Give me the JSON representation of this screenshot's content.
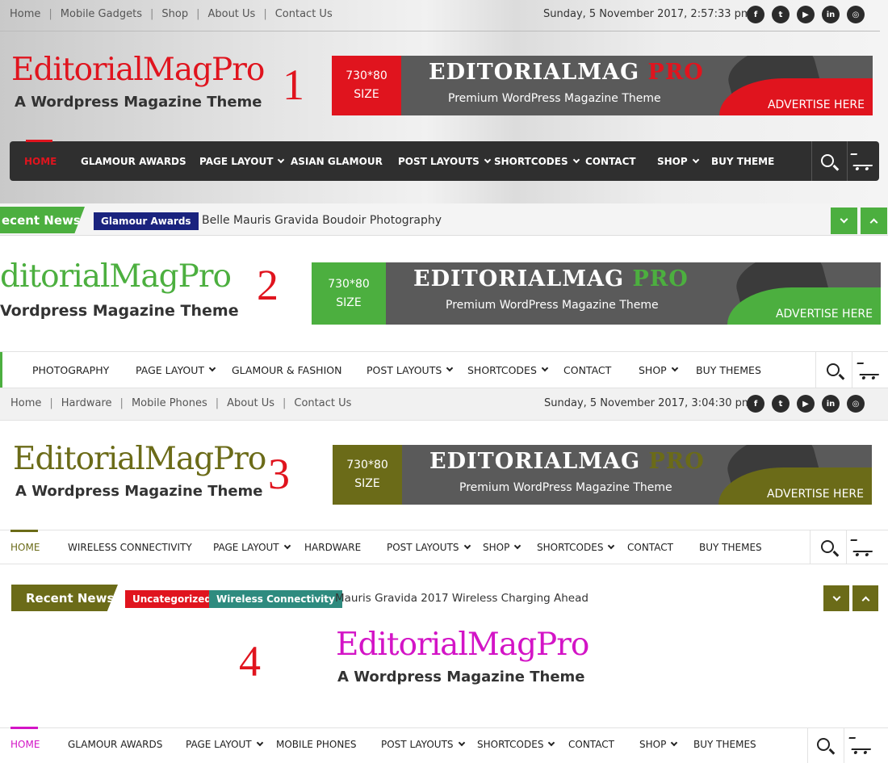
{
  "colors": {
    "red": "#e0141e",
    "green": "#4caf3f",
    "olive": "#6b6b18",
    "magenta": "#d314c6",
    "navy": "#1a237e",
    "teal": "#2e8b7f",
    "dark": "#2f2f2f"
  },
  "social_icons": [
    "facebook-icon",
    "twitter-icon",
    "youtube-icon",
    "linkedin-icon",
    "instagram-icon"
  ],
  "social_glyphs": [
    "f",
    "t",
    "▶",
    "in",
    "◎"
  ],
  "banner": {
    "size_line1": "730*80",
    "size_line2": "SIZE",
    "title_main": "EDITORIALMAG",
    "title_accent": "PRO",
    "subtitle": "Premium WordPress Magazine Theme",
    "advertise": "ADVERTISE HERE"
  },
  "header1": {
    "topnav": [
      "Home",
      "Mobile Gadgets",
      "Shop",
      "About Us",
      "Contact Us"
    ],
    "date": "Sunday, 5 November 2017, 2:57:33 pm",
    "logo": "EditorialMagPro",
    "tagline": "A Wordpress Magazine Theme",
    "number": "1",
    "menu": [
      {
        "label": "HOME",
        "dd": false
      },
      {
        "label": "GLAMOUR AWARDS",
        "dd": false
      },
      {
        "label": "PAGE LAYOUT",
        "dd": true
      },
      {
        "label": "ASIAN GLAMOUR",
        "dd": false
      },
      {
        "label": "POST LAYOUTS",
        "dd": true
      },
      {
        "label": "SHORTCODES",
        "dd": true
      },
      {
        "label": "CONTACT",
        "dd": false
      },
      {
        "label": "SHOP",
        "dd": true
      },
      {
        "label": "BUY THEME",
        "dd": false
      }
    ],
    "ticker_label": "ecent News",
    "ticker_category": "Glamour Awards",
    "ticker_text": "Belle Mauris Gravida Boudoir Photography"
  },
  "header2": {
    "logo": "ditorialMagPro",
    "tagline": "Vordpress Magazine Theme",
    "number": "2",
    "menu": [
      {
        "label": "PHOTOGRAPHY",
        "dd": false
      },
      {
        "label": "PAGE LAYOUT",
        "dd": true
      },
      {
        "label": "GLAMOUR & FASHION",
        "dd": false
      },
      {
        "label": "POST LAYOUTS",
        "dd": true
      },
      {
        "label": "SHORTCODES",
        "dd": true
      },
      {
        "label": "CONTACT",
        "dd": false
      },
      {
        "label": "SHOP",
        "dd": true
      },
      {
        "label": "BUY THEMES",
        "dd": false
      }
    ]
  },
  "header3": {
    "topnav": [
      "Home",
      "Hardware",
      "Mobile Phones",
      "About Us",
      "Contact Us"
    ],
    "date": "Sunday, 5 November 2017, 3:04:30 pm",
    "logo": "EditorialMagPro",
    "tagline": "A Wordpress Magazine Theme",
    "number": "3",
    "menu": [
      {
        "label": "HOME",
        "dd": false
      },
      {
        "label": "WIRELESS CONNECTIVITY",
        "dd": false
      },
      {
        "label": "PAGE LAYOUT",
        "dd": true
      },
      {
        "label": "HARDWARE",
        "dd": false
      },
      {
        "label": "POST LAYOUTS",
        "dd": true
      },
      {
        "label": "SHOP",
        "dd": true
      },
      {
        "label": "SHORTCODES",
        "dd": true
      },
      {
        "label": "CONTACT",
        "dd": false
      },
      {
        "label": "BUY THEMES",
        "dd": false
      }
    ],
    "ticker_label": "Recent News",
    "ticker_cat1": "Uncategorized",
    "ticker_cat2": "Wireless Connectivity",
    "ticker_text": "Mauris Gravida 2017 Wireless Charging Ahead"
  },
  "header4": {
    "logo": "EditorialMagPro",
    "tagline": "A Wordpress Magazine Theme",
    "number": "4",
    "menu": [
      {
        "label": "HOME",
        "dd": false
      },
      {
        "label": "GLAMOUR AWARDS",
        "dd": false
      },
      {
        "label": "PAGE LAYOUT",
        "dd": true
      },
      {
        "label": "MOBILE PHONES",
        "dd": false
      },
      {
        "label": "POST LAYOUTS",
        "dd": true
      },
      {
        "label": "SHORTCODES",
        "dd": true
      },
      {
        "label": "CONTACT",
        "dd": false
      },
      {
        "label": "SHOP",
        "dd": true
      },
      {
        "label": "BUY THEMES",
        "dd": false
      }
    ]
  }
}
